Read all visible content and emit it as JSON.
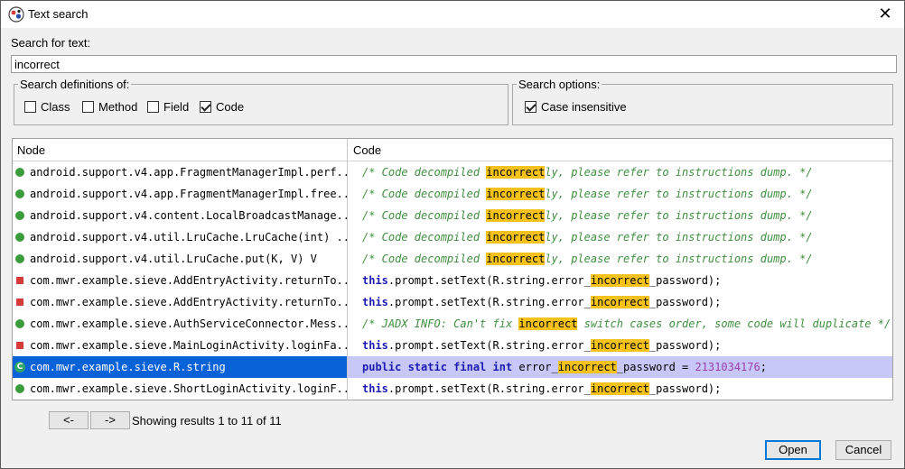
{
  "window": {
    "title": "Text search",
    "close_glyph": "✕"
  },
  "search": {
    "label": "Search for text:",
    "value": "incorrect"
  },
  "definitions": {
    "legend": "Search definitions of:",
    "options": [
      {
        "label": "Class",
        "checked": false
      },
      {
        "label": "Method",
        "checked": false
      },
      {
        "label": "Field",
        "checked": false
      },
      {
        "label": "Code",
        "checked": true
      }
    ]
  },
  "search_options": {
    "legend": "Search options:",
    "options": [
      {
        "label": "Case insensitive",
        "checked": true
      }
    ]
  },
  "table": {
    "headers": {
      "node": "Node",
      "code": "Code"
    },
    "rows": [
      {
        "icon": "method-public-icon",
        "node": "android.support.v4.app.FragmentManagerImpl.perf...",
        "code": [
          [
            "cmt",
            "/* Code decompiled "
          ],
          [
            "hl",
            "incorrect"
          ],
          [
            "cmt",
            "ly, please refer to instructions dump. */"
          ]
        ]
      },
      {
        "icon": "method-public-icon",
        "node": "android.support.v4.app.FragmentManagerImpl.free...",
        "code": [
          [
            "cmt",
            "/* Code decompiled "
          ],
          [
            "hl",
            "incorrect"
          ],
          [
            "cmt",
            "ly, please refer to instructions dump. */"
          ]
        ]
      },
      {
        "icon": "method-public-icon",
        "node": "android.support.v4.content.LocalBroadcastManage...",
        "code": [
          [
            "cmt",
            "/* Code decompiled "
          ],
          [
            "hl",
            "incorrect"
          ],
          [
            "cmt",
            "ly, please refer to instructions dump. */"
          ]
        ]
      },
      {
        "icon": "constructor-icon",
        "node": "android.support.v4.util.LruCache.LruCache(int) ...",
        "code": [
          [
            "cmt",
            "/* Code decompiled "
          ],
          [
            "hl",
            "incorrect"
          ],
          [
            "cmt",
            "ly, please refer to instructions dump. */"
          ]
        ]
      },
      {
        "icon": "final-method-icon",
        "node": "android.support.v4.util.LruCache.put(K, V) V",
        "code": [
          [
            "cmt",
            "/* Code decompiled "
          ],
          [
            "hl",
            "incorrect"
          ],
          [
            "cmt",
            "ly, please refer to instructions dump. */"
          ]
        ]
      },
      {
        "icon": "method-private-icon",
        "node": "com.mwr.example.sieve.AddEntryActivity.returnTo...",
        "code": [
          [
            "kw",
            "this"
          ],
          [
            "txt",
            ".prompt.setText(R.string.error_"
          ],
          [
            "hl",
            "incorrect"
          ],
          [
            "txt",
            "_password);"
          ]
        ]
      },
      {
        "icon": "method-private-icon",
        "node": "com.mwr.example.sieve.AddEntryActivity.returnTo...",
        "code": [
          [
            "kw",
            "this"
          ],
          [
            "txt",
            ".prompt.setText(R.string.error_"
          ],
          [
            "hl",
            "incorrect"
          ],
          [
            "txt",
            "_password);"
          ]
        ]
      },
      {
        "icon": "constructor-icon",
        "node": "com.mwr.example.sieve.AuthServiceConnector.Mess...",
        "code": [
          [
            "cmt",
            "/* JADX INFO: Can't fix "
          ],
          [
            "hl",
            "incorrect"
          ],
          [
            "cmt",
            " switch cases order, some code will duplicate */"
          ]
        ]
      },
      {
        "icon": "method-private-icon",
        "node": "com.mwr.example.sieve.MainLoginActivity.loginFa...",
        "code": [
          [
            "kw",
            "this"
          ],
          [
            "txt",
            ".prompt.setText(R.string.error_"
          ],
          [
            "hl",
            "incorrect"
          ],
          [
            "txt",
            "_password);"
          ]
        ]
      },
      {
        "icon": "class-icon",
        "node": "com.mwr.example.sieve.R.string",
        "selected": true,
        "code": [
          [
            "kw",
            "public static final int"
          ],
          [
            "txt",
            " error_"
          ],
          [
            "hl",
            "incorrect"
          ],
          [
            "txt",
            "_password = "
          ],
          [
            "num",
            "2131034176"
          ],
          [
            "txt",
            ";"
          ]
        ]
      },
      {
        "icon": "method-public-icon",
        "node": "com.mwr.example.sieve.ShortLoginActivity.loginF...",
        "code": [
          [
            "kw",
            "this"
          ],
          [
            "txt",
            ".prompt.setText(R.string.error_"
          ],
          [
            "hl",
            "incorrect"
          ],
          [
            "txt",
            "_password);"
          ]
        ]
      }
    ]
  },
  "pager": {
    "prev_label": "<-",
    "next_label": "->",
    "status": "Showing results 1 to 11 of 11"
  },
  "buttons": {
    "open_label": "Open",
    "cancel_label": "Cancel"
  }
}
